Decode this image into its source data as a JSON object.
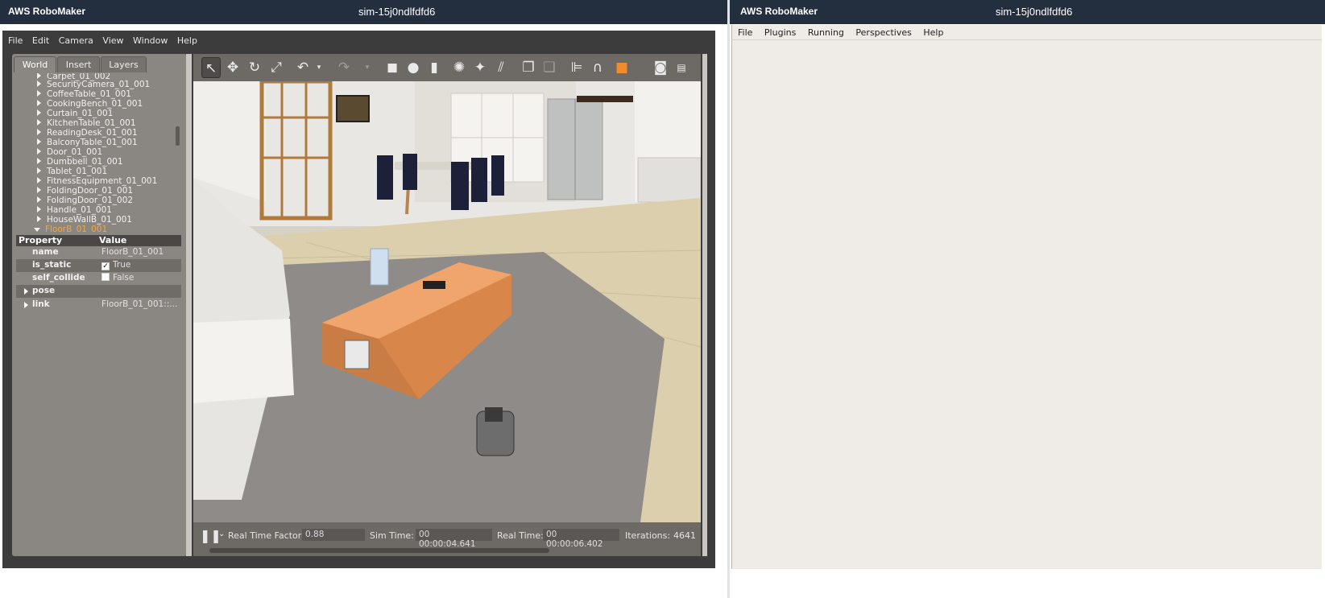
{
  "left_window": {
    "brand": "AWS RoboMaker",
    "sim_name": "sim-15j0ndlfdfd6"
  },
  "gazebo": {
    "menu": [
      "File",
      "Edit",
      "Camera",
      "View",
      "Window",
      "Help"
    ],
    "tabs": [
      "World",
      "Insert",
      "Layers"
    ],
    "tree_items": [
      "Carpet_01_002",
      "SecurityCamera_01_001",
      "CoffeeTable_01_001",
      "CookingBench_01_001",
      "Curtain_01_001",
      "KitchenTable_01_001",
      "ReadingDesk_01_001",
      "BalconyTable_01_001",
      "Door_01_001",
      "Dumbbell_01_001",
      "Tablet_01_001",
      "FitnessEquipment_01_001",
      "FoldingDoor_01_001",
      "FoldingDoor_01_002",
      "Handle_01_001",
      "HouseWallB_01_001",
      "FloorB_01_001"
    ],
    "selected_item": "FloorB_01_001",
    "properties": {
      "header_property": "Property",
      "header_value": "Value",
      "rows": [
        {
          "key": "name",
          "value": "FloorB_01_001"
        },
        {
          "key": "is_static",
          "value": "True",
          "checked": true
        },
        {
          "key": "self_collide",
          "value": "False",
          "checked": false
        },
        {
          "key": "pose",
          "value": ""
        },
        {
          "key": "link",
          "value": "FloorB_01_001::..."
        }
      ]
    },
    "toolbar_icons": [
      "select-arrow-icon",
      "translate-icon",
      "rotate-icon",
      "scale-icon",
      "undo-icon",
      "redo-icon",
      "box-icon",
      "sphere-icon",
      "cylinder-icon",
      "point-light-icon",
      "spot-light-icon",
      "directional-light-icon",
      "copy-icon",
      "paste-icon",
      "align-icon",
      "snap-magnet-icon",
      "view-angle-icon",
      "screenshot-icon",
      "log-icon"
    ],
    "status": {
      "rtf_label": "Real Time Factor:",
      "rtf_value": "0.88",
      "sim_time_label": "Sim Time:",
      "sim_time_value": "00 00:00:04.641",
      "real_time_label": "Real Time:",
      "real_time_value": "00 00:00:06.402",
      "iterations_label": "Iterations:",
      "iterations_value": "4641"
    }
  },
  "right_window": {
    "brand": "AWS RoboMaker",
    "sim_name": "sim-15j0ndlfdfd6",
    "menu": [
      "File",
      "Plugins",
      "Running",
      "Perspectives",
      "Help"
    ]
  },
  "colors": {
    "titlebar": "#232f3e",
    "selected_item": "#f5a442",
    "panel": "#8a8782"
  }
}
